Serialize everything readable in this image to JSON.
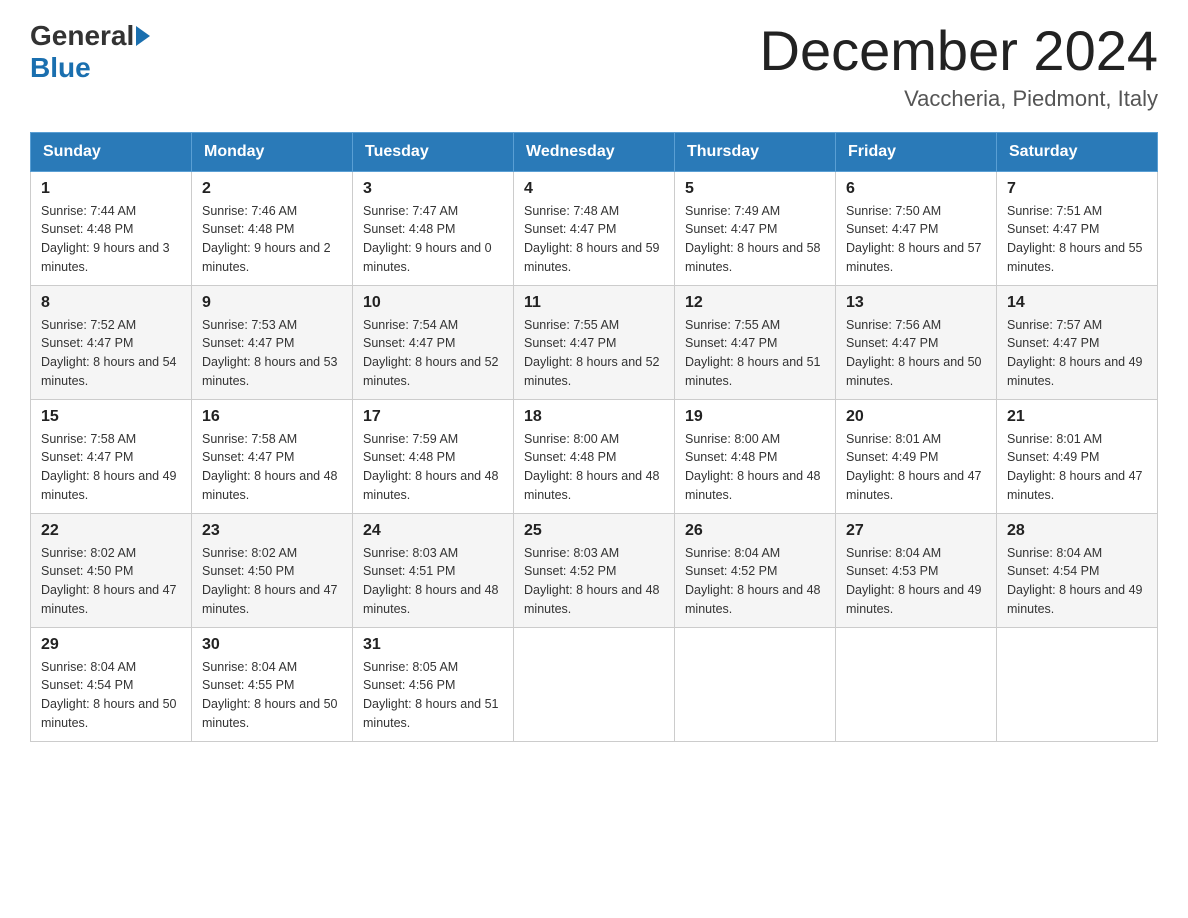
{
  "header": {
    "logo_general": "General",
    "logo_blue": "Blue",
    "month_title": "December 2024",
    "location": "Vaccheria, Piedmont, Italy"
  },
  "weekdays": [
    "Sunday",
    "Monday",
    "Tuesday",
    "Wednesday",
    "Thursday",
    "Friday",
    "Saturday"
  ],
  "weeks": [
    [
      {
        "day": "1",
        "sunrise": "7:44 AM",
        "sunset": "4:48 PM",
        "daylight": "9 hours and 3 minutes."
      },
      {
        "day": "2",
        "sunrise": "7:46 AM",
        "sunset": "4:48 PM",
        "daylight": "9 hours and 2 minutes."
      },
      {
        "day": "3",
        "sunrise": "7:47 AM",
        "sunset": "4:48 PM",
        "daylight": "9 hours and 0 minutes."
      },
      {
        "day": "4",
        "sunrise": "7:48 AM",
        "sunset": "4:47 PM",
        "daylight": "8 hours and 59 minutes."
      },
      {
        "day": "5",
        "sunrise": "7:49 AM",
        "sunset": "4:47 PM",
        "daylight": "8 hours and 58 minutes."
      },
      {
        "day": "6",
        "sunrise": "7:50 AM",
        "sunset": "4:47 PM",
        "daylight": "8 hours and 57 minutes."
      },
      {
        "day": "7",
        "sunrise": "7:51 AM",
        "sunset": "4:47 PM",
        "daylight": "8 hours and 55 minutes."
      }
    ],
    [
      {
        "day": "8",
        "sunrise": "7:52 AM",
        "sunset": "4:47 PM",
        "daylight": "8 hours and 54 minutes."
      },
      {
        "day": "9",
        "sunrise": "7:53 AM",
        "sunset": "4:47 PM",
        "daylight": "8 hours and 53 minutes."
      },
      {
        "day": "10",
        "sunrise": "7:54 AM",
        "sunset": "4:47 PM",
        "daylight": "8 hours and 52 minutes."
      },
      {
        "day": "11",
        "sunrise": "7:55 AM",
        "sunset": "4:47 PM",
        "daylight": "8 hours and 52 minutes."
      },
      {
        "day": "12",
        "sunrise": "7:55 AM",
        "sunset": "4:47 PM",
        "daylight": "8 hours and 51 minutes."
      },
      {
        "day": "13",
        "sunrise": "7:56 AM",
        "sunset": "4:47 PM",
        "daylight": "8 hours and 50 minutes."
      },
      {
        "day": "14",
        "sunrise": "7:57 AM",
        "sunset": "4:47 PM",
        "daylight": "8 hours and 49 minutes."
      }
    ],
    [
      {
        "day": "15",
        "sunrise": "7:58 AM",
        "sunset": "4:47 PM",
        "daylight": "8 hours and 49 minutes."
      },
      {
        "day": "16",
        "sunrise": "7:58 AM",
        "sunset": "4:47 PM",
        "daylight": "8 hours and 48 minutes."
      },
      {
        "day": "17",
        "sunrise": "7:59 AM",
        "sunset": "4:48 PM",
        "daylight": "8 hours and 48 minutes."
      },
      {
        "day": "18",
        "sunrise": "8:00 AM",
        "sunset": "4:48 PM",
        "daylight": "8 hours and 48 minutes."
      },
      {
        "day": "19",
        "sunrise": "8:00 AM",
        "sunset": "4:48 PM",
        "daylight": "8 hours and 48 minutes."
      },
      {
        "day": "20",
        "sunrise": "8:01 AM",
        "sunset": "4:49 PM",
        "daylight": "8 hours and 47 minutes."
      },
      {
        "day": "21",
        "sunrise": "8:01 AM",
        "sunset": "4:49 PM",
        "daylight": "8 hours and 47 minutes."
      }
    ],
    [
      {
        "day": "22",
        "sunrise": "8:02 AM",
        "sunset": "4:50 PM",
        "daylight": "8 hours and 47 minutes."
      },
      {
        "day": "23",
        "sunrise": "8:02 AM",
        "sunset": "4:50 PM",
        "daylight": "8 hours and 47 minutes."
      },
      {
        "day": "24",
        "sunrise": "8:03 AM",
        "sunset": "4:51 PM",
        "daylight": "8 hours and 48 minutes."
      },
      {
        "day": "25",
        "sunrise": "8:03 AM",
        "sunset": "4:52 PM",
        "daylight": "8 hours and 48 minutes."
      },
      {
        "day": "26",
        "sunrise": "8:04 AM",
        "sunset": "4:52 PM",
        "daylight": "8 hours and 48 minutes."
      },
      {
        "day": "27",
        "sunrise": "8:04 AM",
        "sunset": "4:53 PM",
        "daylight": "8 hours and 49 minutes."
      },
      {
        "day": "28",
        "sunrise": "8:04 AM",
        "sunset": "4:54 PM",
        "daylight": "8 hours and 49 minutes."
      }
    ],
    [
      {
        "day": "29",
        "sunrise": "8:04 AM",
        "sunset": "4:54 PM",
        "daylight": "8 hours and 50 minutes."
      },
      {
        "day": "30",
        "sunrise": "8:04 AM",
        "sunset": "4:55 PM",
        "daylight": "8 hours and 50 minutes."
      },
      {
        "day": "31",
        "sunrise": "8:05 AM",
        "sunset": "4:56 PM",
        "daylight": "8 hours and 51 minutes."
      },
      null,
      null,
      null,
      null
    ]
  ]
}
